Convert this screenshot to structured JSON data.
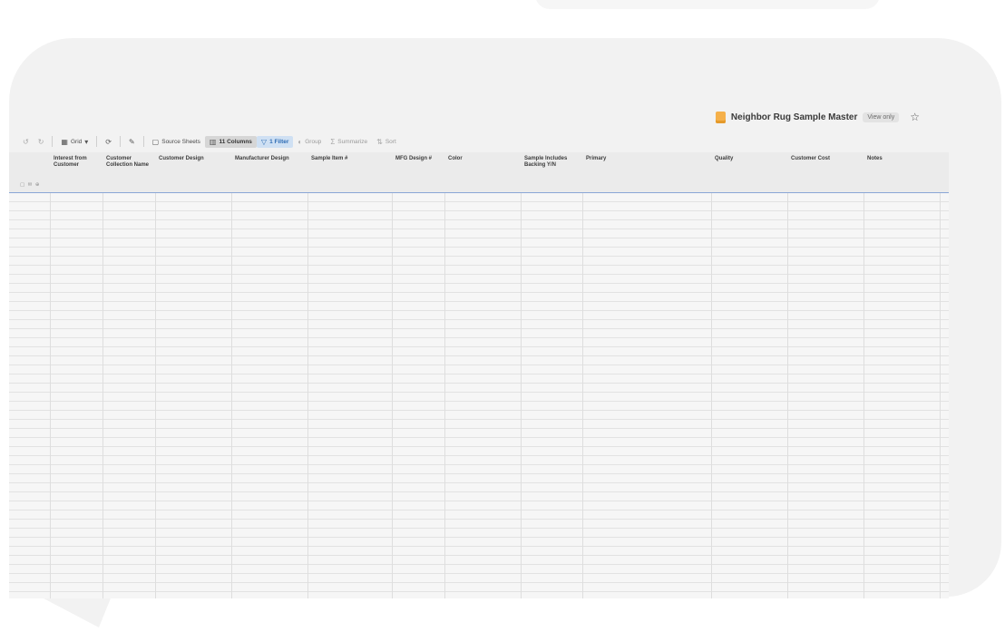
{
  "sheet": {
    "title": "Neighbor Rug Sample Master",
    "badge": "View only",
    "favorite_icon": "star-icon"
  },
  "toolbar": {
    "undo_icon": "↺",
    "redo_icon": "↻",
    "view_label": "Grid",
    "view_caret": "▾",
    "refresh_icon": "⟳",
    "highlight_icon": "✎",
    "source_sheets": "Source Sheets",
    "columns": "11 Columns",
    "filter": "1 Filter",
    "group": "Group",
    "summarize": "Summarize",
    "sort": "Sort"
  },
  "columns": [
    "Interest from Customer",
    "Customer Collection Name",
    "Customer Design",
    "Manufacturer Design",
    "Sample Item #",
    "MFG Design #",
    "Color",
    "Sample Includes Backing Y/N",
    "Primary",
    "Quality",
    "Customer Cost",
    "Notes"
  ],
  "row_tools": "▢ ✉ ⊕",
  "colors": {
    "accent_filter": "#2f6db5",
    "sheet_icon": "#f5b04a",
    "header_underline": "#8aa6d6"
  }
}
